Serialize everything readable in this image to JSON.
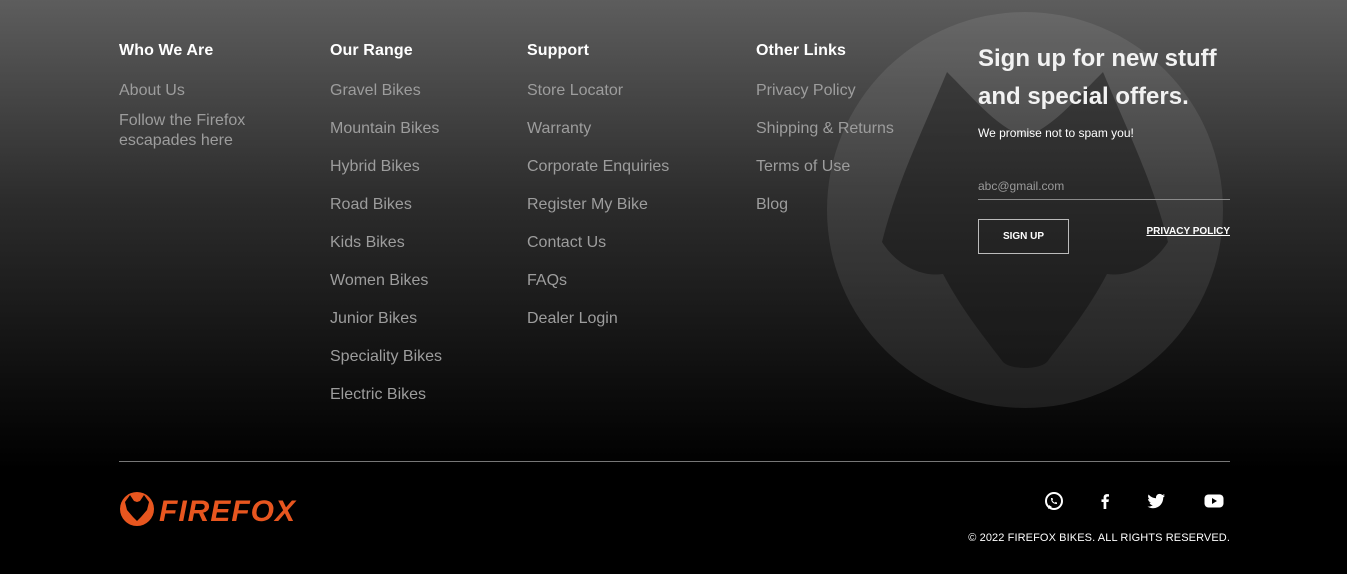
{
  "columns": [
    {
      "heading": "Who We Are",
      "items": [
        "About Us",
        "Follow the Firefox escapades here"
      ]
    },
    {
      "heading": "Our Range",
      "items": [
        "Gravel Bikes",
        "Mountain Bikes",
        "Hybrid Bikes",
        "Road Bikes",
        "Kids Bikes",
        "Women Bikes",
        "Junior Bikes",
        "Speciality Bikes",
        "Electric Bikes"
      ]
    },
    {
      "heading": "Support",
      "items": [
        "Store Locator",
        "Warranty",
        "Corporate Enquiries",
        "Register My Bike",
        "Contact Us",
        "FAQs",
        "Dealer Login"
      ]
    },
    {
      "heading": "Other Links",
      "items": [
        "Privacy Policy",
        "Shipping & Returns",
        "Terms of Use",
        "Blog"
      ]
    }
  ],
  "signup": {
    "title": "Sign up for new stuff and special offers.",
    "subtitle": "We promise not to spam you!",
    "email_placeholder": "abc@gmail.com",
    "button_label": "SIGN UP",
    "privacy_label": "PRIVACY POLICY"
  },
  "brand": {
    "logo_text": "FIREFOX",
    "logo_color": "#e8561f"
  },
  "social_icons": [
    "whatsapp-icon",
    "facebook-icon",
    "twitter-icon",
    "youtube-icon"
  ],
  "copyright": "© 2022 FIREFOX BIKES. ALL RIGHTS RESERVED."
}
